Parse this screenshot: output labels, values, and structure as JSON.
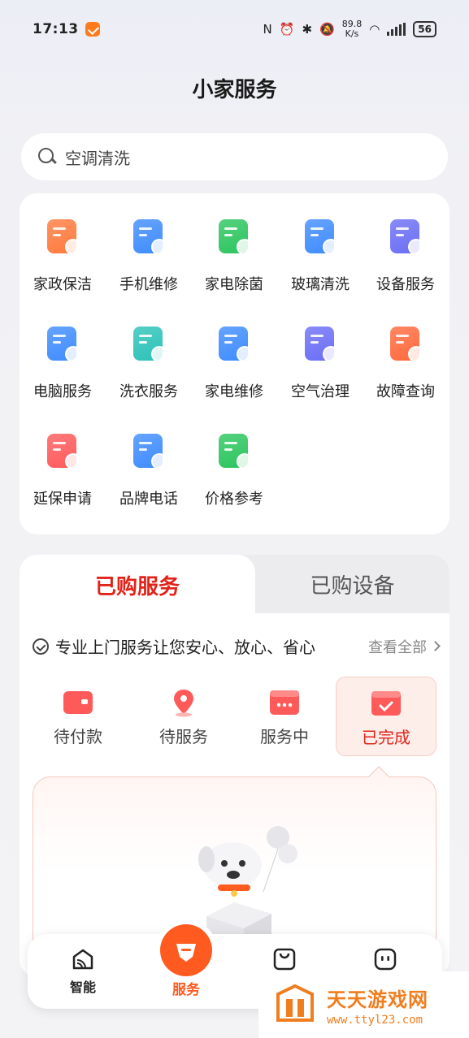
{
  "status_bar": {
    "time": "17:13",
    "net_speed": "89.8",
    "net_unit": "K/s",
    "battery": "56"
  },
  "page": {
    "title": "小家服务"
  },
  "search": {
    "text": "空调清洗"
  },
  "services": [
    {
      "label": "家政保洁",
      "icon": "broom-icon",
      "color": "#ff7a3d"
    },
    {
      "label": "手机维修",
      "icon": "phone-repair-icon",
      "color": "#3f8cff"
    },
    {
      "label": "家电除菌",
      "icon": "appliance-sterilize-icon",
      "color": "#2cc55e"
    },
    {
      "label": "玻璃清洗",
      "icon": "glass-clean-icon",
      "color": "#3f8cff"
    },
    {
      "label": "设备服务",
      "icon": "device-service-icon",
      "color": "#6b6ef5"
    },
    {
      "label": "电脑服务",
      "icon": "computer-service-icon",
      "color": "#3f8cff"
    },
    {
      "label": "洗衣服务",
      "icon": "laundry-icon",
      "color": "#2cc2b8"
    },
    {
      "label": "家电维修",
      "icon": "appliance-repair-icon",
      "color": "#3f8cff"
    },
    {
      "label": "空气治理",
      "icon": "air-spray-icon",
      "color": "#6b6ef5"
    },
    {
      "label": "故障查询",
      "icon": "fault-query-icon",
      "color": "#ff6a3d"
    },
    {
      "label": "延保申请",
      "icon": "warranty-icon",
      "color": "#ff5a5a"
    },
    {
      "label": "品牌电话",
      "icon": "brand-phone-icon",
      "color": "#3f8cff"
    },
    {
      "label": "价格参考",
      "icon": "price-reference-icon",
      "color": "#2cc55e"
    }
  ],
  "orders": {
    "tab_active": "已购服务",
    "tab_inactive": "已购设备",
    "promo": "专业上门服务让您安心、放心、省心",
    "view_all": "查看全部",
    "statuses": [
      {
        "label": "待付款",
        "icon": "wallet-icon"
      },
      {
        "label": "待服务",
        "icon": "location-pin-icon"
      },
      {
        "label": "服务中",
        "icon": "in-progress-icon"
      },
      {
        "label": "已完成",
        "icon": "completed-icon"
      }
    ],
    "accent": "#e2231a"
  },
  "bottom_nav": {
    "items": [
      {
        "label": "智能",
        "icon": "smart-home-icon"
      },
      {
        "label": "服务",
        "icon": "service-icon"
      },
      {
        "label": "",
        "icon": "shopping-bag-icon"
      },
      {
        "label": "",
        "icon": "profile-face-icon"
      }
    ],
    "accent": "#ff5a1f"
  },
  "watermark": {
    "title": "天天游戏网",
    "url": "www.ttyl23.com"
  }
}
